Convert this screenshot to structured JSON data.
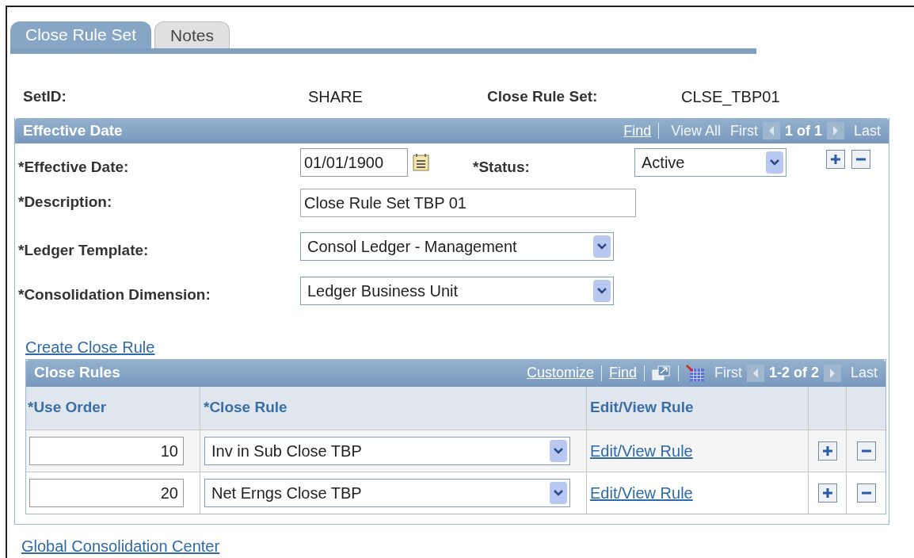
{
  "tabs": [
    {
      "label": "Close Rule Set",
      "selected": true
    },
    {
      "label": "Notes",
      "selected": false
    }
  ],
  "header_fields": [
    {
      "label": "SetID:",
      "value": "SHARE"
    },
    {
      "label": "Close Rule Set:",
      "value": "CLSE_TBP01"
    }
  ],
  "effective_date_panel": {
    "title": "Effective Date",
    "nav": [
      {
        "kind": "link",
        "text": "Find"
      },
      {
        "kind": "text",
        "text": "View All"
      },
      {
        "kind": "text",
        "text": "First"
      },
      {
        "kind": "prev"
      },
      {
        "kind": "count",
        "text": "1 of 1"
      },
      {
        "kind": "next"
      },
      {
        "kind": "text",
        "text": "Last"
      }
    ],
    "effective_date": {
      "label": "*Effective Date:",
      "value": "01/01/1900"
    },
    "status": {
      "label": "*Status:",
      "value": "Active"
    },
    "description": {
      "label": "*Description:",
      "value": "Close Rule Set TBP 01"
    },
    "ledger_template": {
      "label": "*Ledger Template:",
      "value": "Consol Ledger - Management"
    },
    "consolidation_dimension": {
      "label": "*Consolidation Dimension:",
      "value": "Ledger Business Unit"
    },
    "create_link": "Create Close Rule",
    "close_rules": {
      "title": "Close Rules",
      "nav": [
        {
          "kind": "link",
          "text": "Customize"
        },
        {
          "kind": "link",
          "text": "Find"
        },
        {
          "kind": "zoom"
        },
        {
          "kind": "download"
        },
        {
          "kind": "text",
          "text": "First"
        },
        {
          "kind": "prev"
        },
        {
          "kind": "count",
          "text": "1-2 of 2"
        },
        {
          "kind": "next"
        },
        {
          "kind": "text",
          "text": "Last"
        }
      ],
      "columns": [
        "*Use Order",
        "*Close Rule",
        "Edit/View Rule"
      ],
      "rows": [
        {
          "use_order": "10",
          "close_rule": "Inv in Sub Close TBP",
          "link": "Edit/View Rule"
        },
        {
          "use_order": "20",
          "close_rule": "Net Erngs Close TBP",
          "link": "Edit/View Rule"
        }
      ]
    }
  },
  "footer_link": "Global Consolidation Center"
}
